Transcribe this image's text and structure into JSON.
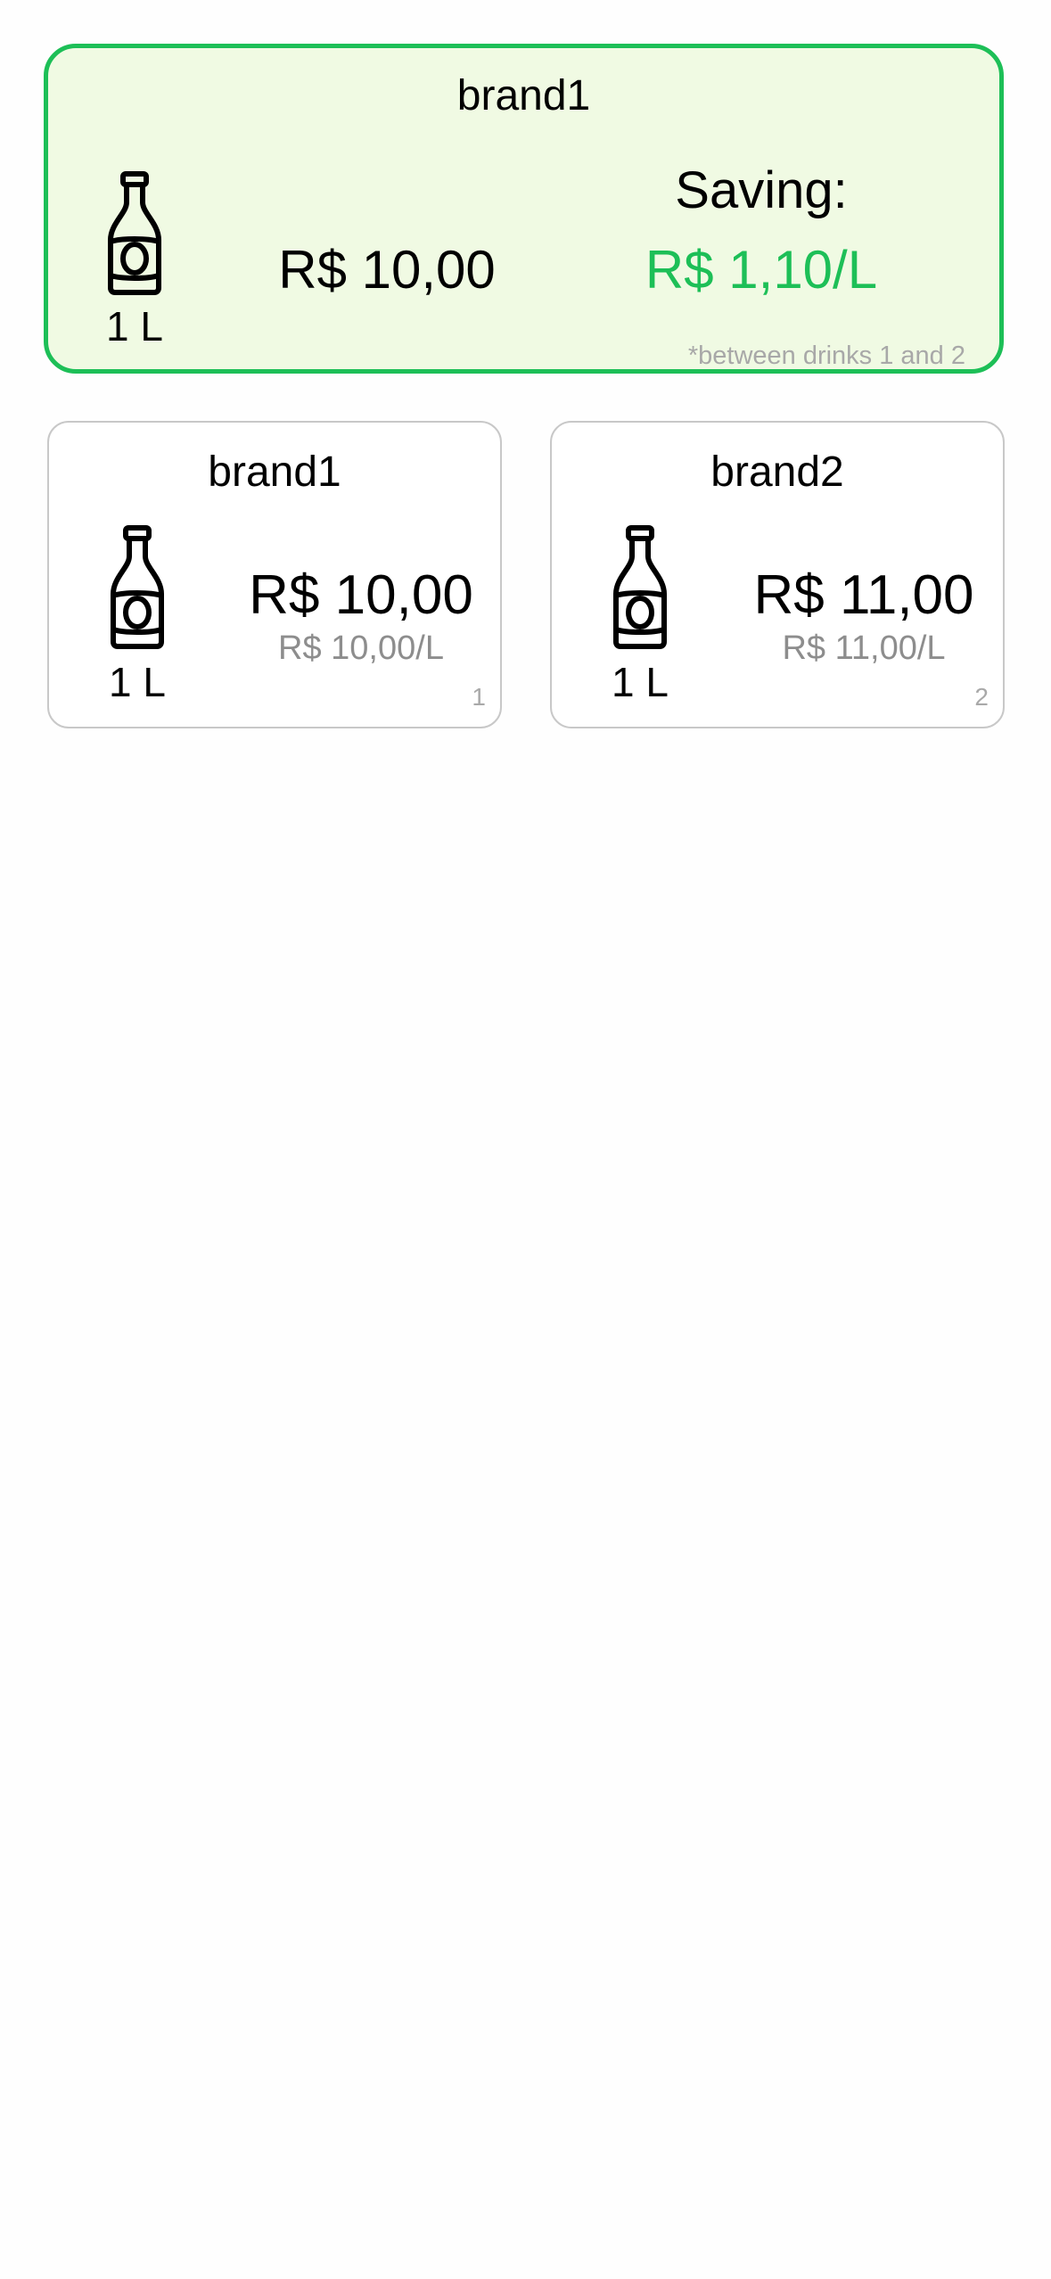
{
  "colors": {
    "accent_green": "#1dbf57",
    "best_card_background": "#f0fae3",
    "muted_text": "#8d8d8d",
    "card_border": "#c8c8c8"
  },
  "best_deal": {
    "brand": "brand1",
    "bottle_icon": "bottle-icon",
    "volume": "1 L",
    "price": "R$ 10,00",
    "saving_label": "Saving:",
    "saving_value": "R$ 1,10/L",
    "note": "*between drinks 1 and 2"
  },
  "drinks": [
    {
      "brand": "brand1",
      "bottle_icon": "bottle-icon",
      "volume": "1 L",
      "price": "R$ 10,00",
      "price_per_liter": "R$ 10,00/L",
      "index": "1"
    },
    {
      "brand": "brand2",
      "bottle_icon": "bottle-icon",
      "volume": "1 L",
      "price": "R$ 11,00",
      "price_per_liter": "R$ 11,00/L",
      "index": "2"
    }
  ]
}
